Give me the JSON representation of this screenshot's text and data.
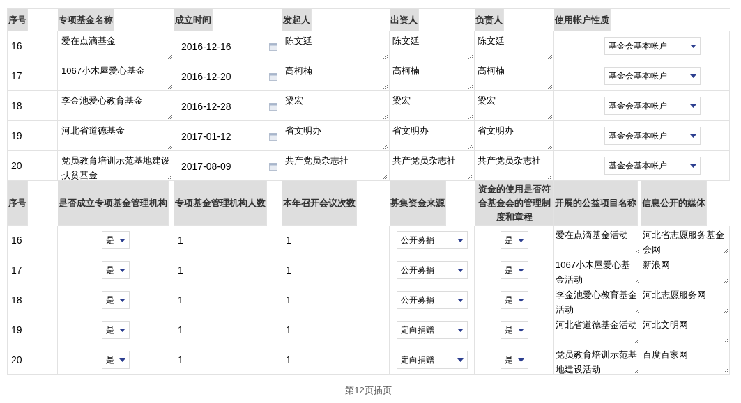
{
  "table1": {
    "columns": [
      "序号",
      "专项基金名称",
      "成立时间",
      "发起人",
      "出资人",
      "负责人",
      "使用帐户性质"
    ],
    "rows": [
      {
        "no": "16",
        "name": "爱在点滴基金",
        "date": "2016-12-16",
        "initiator": "陈文廷",
        "funder": "陈文廷",
        "manager": "陈文廷",
        "account": "基金会基本帐户"
      },
      {
        "no": "17",
        "name": "1067小木屋爱心基金",
        "date": "2016-12-20",
        "initiator": "高柯楠",
        "funder": "高柯楠",
        "manager": "高柯楠",
        "account": "基金会基本帐户"
      },
      {
        "no": "18",
        "name": "李金池爱心教育基金",
        "date": "2016-12-28",
        "initiator": "梁宏",
        "funder": "梁宏",
        "manager": "梁宏",
        "account": "基金会基本帐户"
      },
      {
        "no": "19",
        "name": "河北省道德基金",
        "date": "2017-01-12",
        "initiator": "省文明办",
        "funder": "省文明办",
        "manager": "省文明办",
        "account": "基金会基本帐户"
      },
      {
        "no": "20",
        "name": "党员教育培训示范基地建设扶贫基金",
        "date": "2017-08-09",
        "initiator": "共产党员杂志社",
        "funder": "共产党员杂志社",
        "manager": "共产党员杂志社",
        "account": "基金会基本帐户"
      }
    ]
  },
  "table2": {
    "columns": [
      "序号",
      "是否成立专项基金管理机构",
      "专项基金管理机构人数",
      "本年召开会议次数",
      "募集资金来源",
      "资金的使用是否符合基金会的管理制度和章程",
      "开展的公益项目名称",
      "信息公开的媒体"
    ],
    "rows": [
      {
        "no": "16",
        "has_org": "是",
        "org_size": "1",
        "meetings": "1",
        "source": "公开募捐",
        "compliant": "是",
        "project": "爱在点滴基金活动",
        "media": "河北省志愿服务基金会网"
      },
      {
        "no": "17",
        "has_org": "是",
        "org_size": "1",
        "meetings": "1",
        "source": "公开募捐",
        "compliant": "是",
        "project": "1067小木屋爱心基金活动",
        "media": "新浪网"
      },
      {
        "no": "18",
        "has_org": "是",
        "org_size": "1",
        "meetings": "1",
        "source": "公开募捐",
        "compliant": "是",
        "project": "李金池爱心教育基金活动",
        "media": "河北志愿服务网"
      },
      {
        "no": "19",
        "has_org": "是",
        "org_size": "1",
        "meetings": "1",
        "source": "定向捐赠",
        "compliant": "是",
        "project": "河北省道德基金活动",
        "media": "河北文明网"
      },
      {
        "no": "20",
        "has_org": "是",
        "org_size": "1",
        "meetings": "1",
        "source": "定向捐赠",
        "compliant": "是",
        "project": "党员教育培训示范基地建设活动",
        "media": "百度百家网"
      }
    ]
  },
  "footer": "第12页插页"
}
